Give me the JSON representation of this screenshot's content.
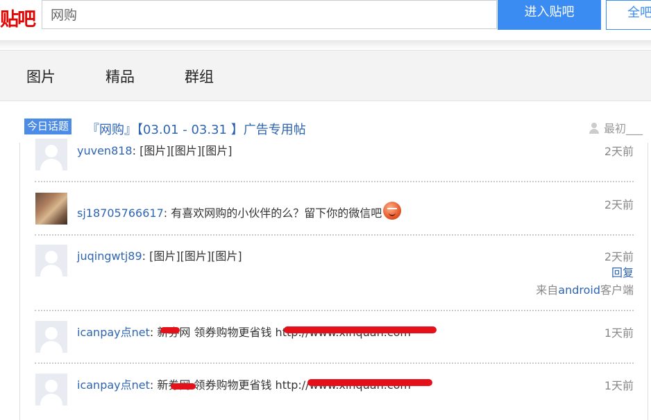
{
  "header": {
    "logo": "贴吧",
    "search_value": "网购",
    "enter_button": "进入贴吧",
    "all_button": "全吧"
  },
  "nav": {
    "tabs": [
      "图片",
      "精品",
      "群组"
    ]
  },
  "topic": {
    "badge": "今日话题",
    "title": "『网购』【03.01 - 03.31 】广告专用帖",
    "earliest": "最初___"
  },
  "posts": [
    {
      "author": "yuven818",
      "text": "[图片][图片][图片]",
      "time": "2天前"
    },
    {
      "author": "sj18705766617",
      "text": "有喜欢网购的小伙伴的么？留下你的微信吧",
      "time": "2天前"
    },
    {
      "author": "juqingwtj89",
      "text": "[图片][图片][图片]",
      "time": "2天前",
      "reply": "回复",
      "client_prefix": "来自",
      "client_link": "android",
      "client_suffix": "客户端"
    },
    {
      "author": "icanpay点net",
      "text": "新券网 领券购物更省钱 http://www.xinquan.com",
      "time": "1天前"
    },
    {
      "author": "icanpay点net",
      "text": "新券网 领券购物更省钱 http://www.xinquan.com",
      "time": "1天前"
    }
  ],
  "colors": {
    "accent": "#3a8cf2",
    "link": "#2d64b3",
    "logo": "#e10602",
    "redaction": "#e4101a"
  }
}
